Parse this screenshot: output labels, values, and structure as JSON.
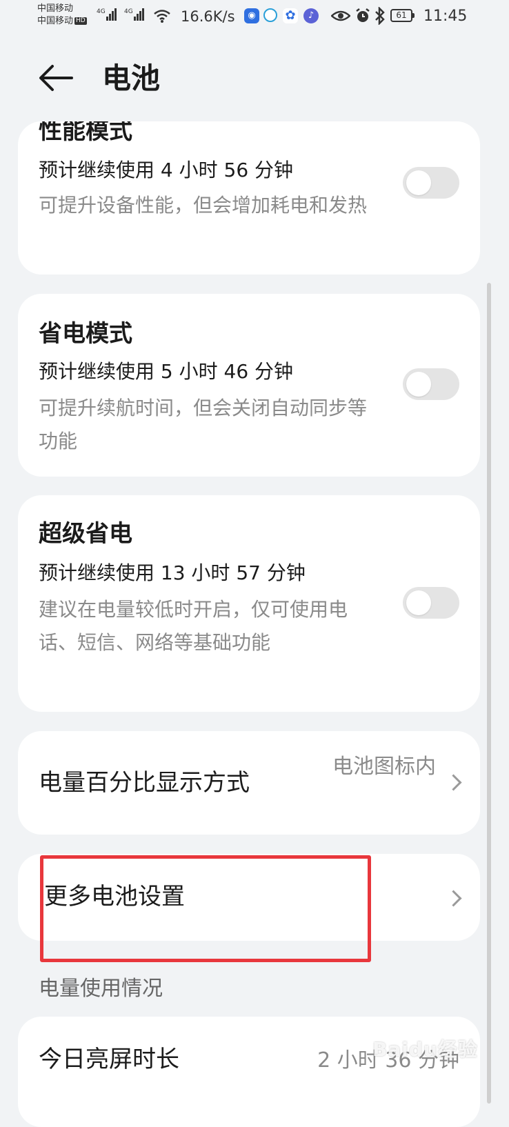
{
  "status_bar": {
    "carrier_1": "中国移动",
    "carrier_2": "中国移动",
    "hd_badge": "HD",
    "network_1": "4G",
    "network_2": "4G",
    "speed": "16.6K/s",
    "battery_level": "61",
    "time": "11:45",
    "icons": [
      "wifi-icon",
      "eye-icon",
      "alarm-icon",
      "bluetooth-icon"
    ]
  },
  "header": {
    "title": "电池"
  },
  "modes": {
    "performance": {
      "title": "性能模式",
      "estimate": "预计继续使用 4 小时 56 分钟",
      "desc": "可提升设备性能，但会增加耗电和发热",
      "enabled": false
    },
    "power_saving": {
      "title": "省电模式",
      "estimate": "预计继续使用 5 小时 46 分钟",
      "desc": "可提升续航时间，但会关闭自动同步等功能",
      "enabled": false
    },
    "super_saving": {
      "title": "超级省电",
      "estimate": "预计继续使用 13 小时 57 分钟",
      "desc": "建议在电量较低时开启，仅可使用电话、短信、网络等基础功能",
      "enabled": false
    }
  },
  "settings": {
    "percentage_display": {
      "label": "电量百分比显示方式",
      "value": "电池图标内"
    },
    "more_settings": {
      "label": "更多电池设置"
    }
  },
  "usage": {
    "section_title": "电量使用情况",
    "screen_time_label": "今日亮屏时长",
    "screen_time_value": "2 小时 36 分钟"
  },
  "watermark": "Baidu经验",
  "colors": {
    "background": "#f1f3f5",
    "card": "#ffffff",
    "toggle_off": "#e4e4e4",
    "secondary_text": "#8a8a8a",
    "highlight": "#e8373c"
  }
}
